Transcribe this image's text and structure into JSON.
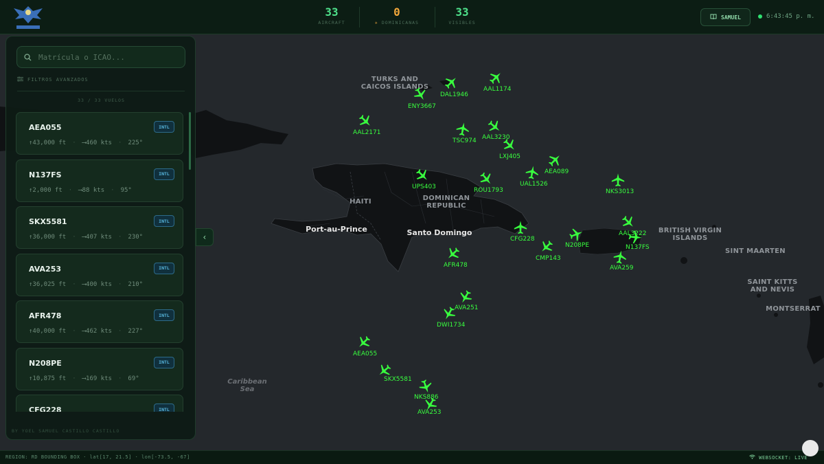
{
  "header": {
    "stats": [
      {
        "value": "33",
        "label": "AIRCRAFT",
        "color": "#4ee08a"
      },
      {
        "value": "0",
        "label": "DOMINICANAS",
        "color": "#f0a63a"
      },
      {
        "value": "33",
        "label": "VISIBLES",
        "color": "#4ee08a"
      }
    ],
    "user_label": "SAMUEL",
    "clock": "6:43:45 p. m."
  },
  "sidebar": {
    "search_placeholder": "Matrícula o ICAO...",
    "filters_label": "FILTROS AVANZADOS",
    "count_label": "33 / 33 VUELOS",
    "flights": [
      {
        "callsign": "AEA055",
        "tag": "INTL",
        "altitude": "43,000 ft",
        "speed": "460 kts",
        "heading": "225°"
      },
      {
        "callsign": "N137FS",
        "tag": "INTL",
        "altitude": "2,000 ft",
        "speed": "88 kts",
        "heading": "95°"
      },
      {
        "callsign": "SKX5581",
        "tag": "INTL",
        "altitude": "36,000 ft",
        "speed": "407 kts",
        "heading": "230°"
      },
      {
        "callsign": "AVA253",
        "tag": "INTL",
        "altitude": "36,025 ft",
        "speed": "400 kts",
        "heading": "210°"
      },
      {
        "callsign": "AFR478",
        "tag": "INTL",
        "altitude": "40,000 ft",
        "speed": "462 kts",
        "heading": "227°"
      },
      {
        "callsign": "N208PE",
        "tag": "INTL",
        "altitude": "10,875 ft",
        "speed": "169 kts",
        "heading": "69°"
      },
      {
        "callsign": "CFG228",
        "tag": "INTL",
        "altitude": "",
        "speed": "",
        "heading": ""
      }
    ],
    "credit": "BY YOEL SAMUEL CASTILLO CASTILLO"
  },
  "map": {
    "places": {
      "turks": "TURKS AND\nCAICOS ISLANDS",
      "haiti": "HAITI",
      "dr": "DOMINICAN\nREPUBLIC",
      "bvi": "BRITISH VIRGIN\nISLANDS",
      "sint_maarten": "SINT MAARTEN",
      "skn": "SAINT KITTS\nAND NEVIS",
      "montserrat": "MONTSERRAT",
      "pap": "Port-au-Prince",
      "sd": "Santo Domingo",
      "sea": "Caribbean\nSea"
    },
    "planes": [
      {
        "callsign": "AAL1174",
        "heading": 45
      },
      {
        "callsign": "DAL1946",
        "heading": 45
      },
      {
        "callsign": "ENY3667",
        "heading": 150
      },
      {
        "callsign": "AAL2171",
        "heading": 135
      },
      {
        "callsign": "TSC974",
        "heading": 10
      },
      {
        "callsign": "AAL3230",
        "heading": 130
      },
      {
        "callsign": "LXJ405",
        "heading": 135
      },
      {
        "callsign": "AEA089",
        "heading": 45
      },
      {
        "callsign": "UAL1526",
        "heading": 10
      },
      {
        "callsign": "UPS403",
        "heading": 135
      },
      {
        "callsign": "ROU1793",
        "heading": 140
      },
      {
        "callsign": "NKS3013",
        "heading": 0
      },
      {
        "callsign": "CFG228",
        "heading": 0
      },
      {
        "callsign": "N208PE",
        "heading": 69
      },
      {
        "callsign": "CMP143",
        "heading": 225
      },
      {
        "callsign": "AAL3222",
        "heading": 135
      },
      {
        "callsign": "N137FS",
        "heading": 95
      },
      {
        "callsign": "AVA259",
        "heading": 10
      },
      {
        "callsign": "AFR478",
        "heading": 227
      },
      {
        "callsign": "AVA251",
        "heading": 210
      },
      {
        "callsign": "DWI1734",
        "heading": 210
      },
      {
        "callsign": "AEA055",
        "heading": 225
      },
      {
        "callsign": "SKX5581",
        "heading": 230
      },
      {
        "callsign": "NKS886",
        "heading": 160
      },
      {
        "callsign": "AVA253",
        "heading": 210
      }
    ]
  },
  "footer": {
    "region": "REGION: RD BOUNDING BOX · lat[17, 21.5] · lon[-73.5, -67]",
    "status": "WEBSOCKET: LIVE"
  }
}
